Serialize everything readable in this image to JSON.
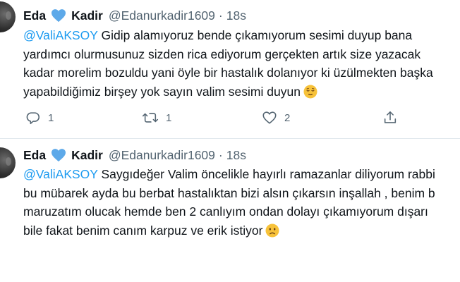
{
  "tweets": [
    {
      "author": {
        "first": "Eda",
        "second": "Kadir",
        "handle": "@Edanurkadir1609",
        "separator": "·",
        "time": "18s"
      },
      "lines": [
        {
          "mention": "@ValiAKSOY",
          "text": " Gidip alamıyoruz bende çıkamıyorum sesimi duyup bana"
        },
        {
          "mention": "",
          "text": "yardımcı olurmusunuz sizden rica ediyorum gerçekten artık size yazacak"
        },
        {
          "mention": "",
          "text": "kadar morelim bozuldu yani öyle bir hastalık dolanıyor ki üzülmekten başka"
        },
        {
          "mention": "",
          "text": "yapabildiğimiz birşey yok sayın valim sesimi duyun"
        }
      ],
      "emoji": "relieved-face",
      "actions": {
        "reply": "1",
        "retweet": "1",
        "like": "2"
      }
    },
    {
      "author": {
        "first": "Eda",
        "second": "Kadir",
        "handle": "@Edanurkadir1609",
        "separator": "·",
        "time": "18s"
      },
      "lines": [
        {
          "mention": "@ValiAKSOY",
          "text": " Saygıdeğer Valim  öncelikle hayırlı ramazanlar diliyorum rabbi"
        },
        {
          "mention": "",
          "text": "bu mübarek ayda bu berbat hastalıktan bizi alsın çıkarsın inşallah , benim b"
        },
        {
          "mention": "",
          "text": "maruzatım olucak hemde ben 2 canlıyım ondan dolayı çıkamıyorum dışarı"
        },
        {
          "mention": "",
          "text": "bile fakat benim canım karpuz ve erik istiyor"
        }
      ],
      "emoji": "frowning-face"
    }
  ],
  "icons": {
    "heart": "blue-heart-icon",
    "reply": "reply-icon",
    "retweet": "retweet-icon",
    "like": "like-icon",
    "share": "share-icon"
  },
  "colors": {
    "mention": "#1d9bf0",
    "heart": "#5da9e9",
    "secondary_text": "#536471",
    "divider": "#e1e8ed"
  }
}
